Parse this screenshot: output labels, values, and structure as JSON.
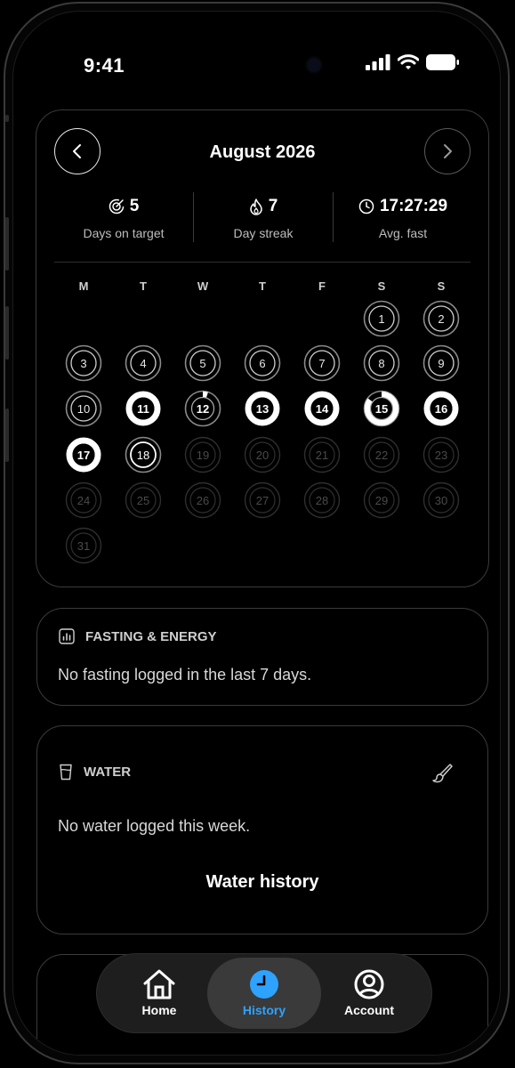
{
  "status_bar": {
    "time": "9:41"
  },
  "calendar": {
    "month_title": "August 2026",
    "prev_icon": "chevron-left-icon",
    "next_icon": "chevron-right-icon",
    "stats": [
      {
        "icon": "target-icon",
        "value": "5",
        "label": "Days on target"
      },
      {
        "icon": "flame-icon",
        "value": "7",
        "label": "Day streak"
      },
      {
        "icon": "clock-icon",
        "value": "17:27:29",
        "label": "Avg. fast"
      }
    ],
    "weekdays": [
      "M",
      "T",
      "W",
      "T",
      "F",
      "S",
      "S"
    ],
    "days": [
      {
        "n": "1",
        "state": "past"
      },
      {
        "n": "2",
        "state": "past"
      },
      {
        "n": "3",
        "state": "past"
      },
      {
        "n": "4",
        "state": "past"
      },
      {
        "n": "5",
        "state": "past"
      },
      {
        "n": "6",
        "state": "past"
      },
      {
        "n": "7",
        "state": "past"
      },
      {
        "n": "8",
        "state": "past"
      },
      {
        "n": "9",
        "state": "past"
      },
      {
        "n": "10",
        "state": "past"
      },
      {
        "n": "11",
        "state": "full"
      },
      {
        "n": "12",
        "state": "partial",
        "progress": 0.05
      },
      {
        "n": "13",
        "state": "full"
      },
      {
        "n": "14",
        "state": "full"
      },
      {
        "n": "15",
        "state": "partial",
        "progress": 0.85
      },
      {
        "n": "16",
        "state": "full"
      },
      {
        "n": "17",
        "state": "full"
      },
      {
        "n": "18",
        "state": "today"
      },
      {
        "n": "19",
        "state": "future"
      },
      {
        "n": "20",
        "state": "future"
      },
      {
        "n": "21",
        "state": "future"
      },
      {
        "n": "22",
        "state": "future"
      },
      {
        "n": "23",
        "state": "future"
      },
      {
        "n": "24",
        "state": "future"
      },
      {
        "n": "25",
        "state": "future"
      },
      {
        "n": "26",
        "state": "future"
      },
      {
        "n": "27",
        "state": "future"
      },
      {
        "n": "28",
        "state": "future"
      },
      {
        "n": "29",
        "state": "future"
      },
      {
        "n": "30",
        "state": "future"
      },
      {
        "n": "31",
        "state": "future"
      }
    ]
  },
  "fasting": {
    "icon": "bar-chart-icon",
    "title": "FASTING & ENERGY",
    "message": "No fasting logged in the last 7 days."
  },
  "water": {
    "icon": "glass-icon",
    "title": "WATER",
    "edit_icon": "brush-icon",
    "message": "No water logged this week.",
    "link": "Water history"
  },
  "tabs": [
    {
      "icon": "home-icon",
      "label": "Home",
      "active": false
    },
    {
      "icon": "clock-icon",
      "label": "History",
      "active": true
    },
    {
      "icon": "account-icon",
      "label": "Account",
      "active": false
    }
  ],
  "colors": {
    "accent": "#2ea2ff",
    "background": "#000000",
    "card_border": "#3b3b3b"
  }
}
